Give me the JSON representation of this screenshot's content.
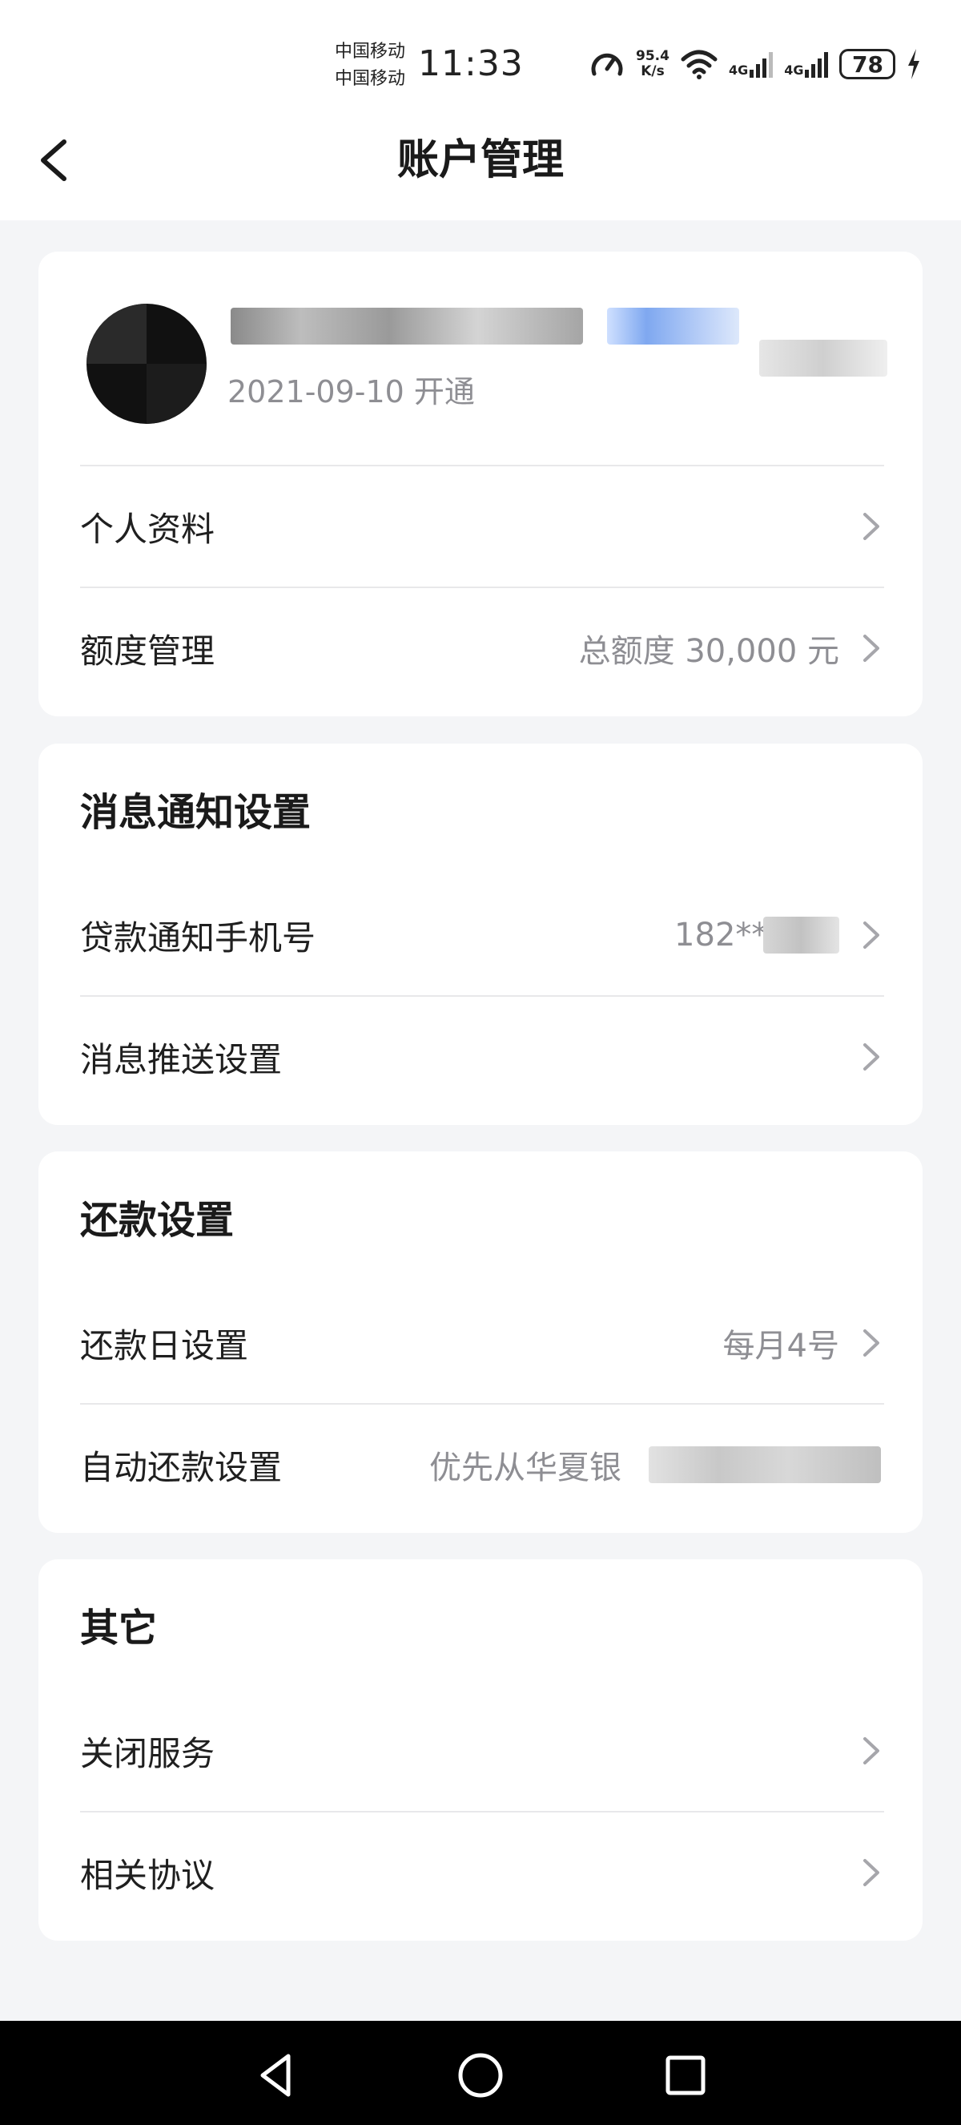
{
  "status_bar": {
    "carrier_1": "中国移动",
    "carrier_2": "中国移动",
    "time": "11:33",
    "net_speed_value": "95.4",
    "net_speed_unit": "K/s",
    "network_1": "4G",
    "network_2": "4G",
    "battery": "78"
  },
  "header": {
    "title": "账户管理"
  },
  "account_card": {
    "open_date": "2021-09-10 开通",
    "items": [
      {
        "label": "个人资料",
        "value": ""
      },
      {
        "label": "额度管理",
        "value": "总额度 30,000 元"
      }
    ]
  },
  "notify_card": {
    "title": "消息通知设置",
    "items": [
      {
        "label": "贷款通知手机号",
        "value": "182****("
      },
      {
        "label": "消息推送设置",
        "value": ""
      }
    ]
  },
  "repay_card": {
    "title": "还款设置",
    "items": [
      {
        "label": "还款日设置",
        "value": "每月4号"
      },
      {
        "label": "自动还款设置",
        "value": "优先从华夏银"
      }
    ]
  },
  "other_card": {
    "title": "其它",
    "items": [
      {
        "label": "关闭服务",
        "value": ""
      },
      {
        "label": "相关协议",
        "value": ""
      }
    ]
  },
  "icons": {
    "back": "chevron-left-icon",
    "row": "chevron-right-icon",
    "sys_back": "triangle-back-icon",
    "sys_home": "circle-home-icon",
    "sys_recent": "square-recent-icon"
  },
  "colors": {
    "background": "#f4f5f7",
    "card": "#ffffff",
    "secondary_text": "#8e8e93"
  }
}
